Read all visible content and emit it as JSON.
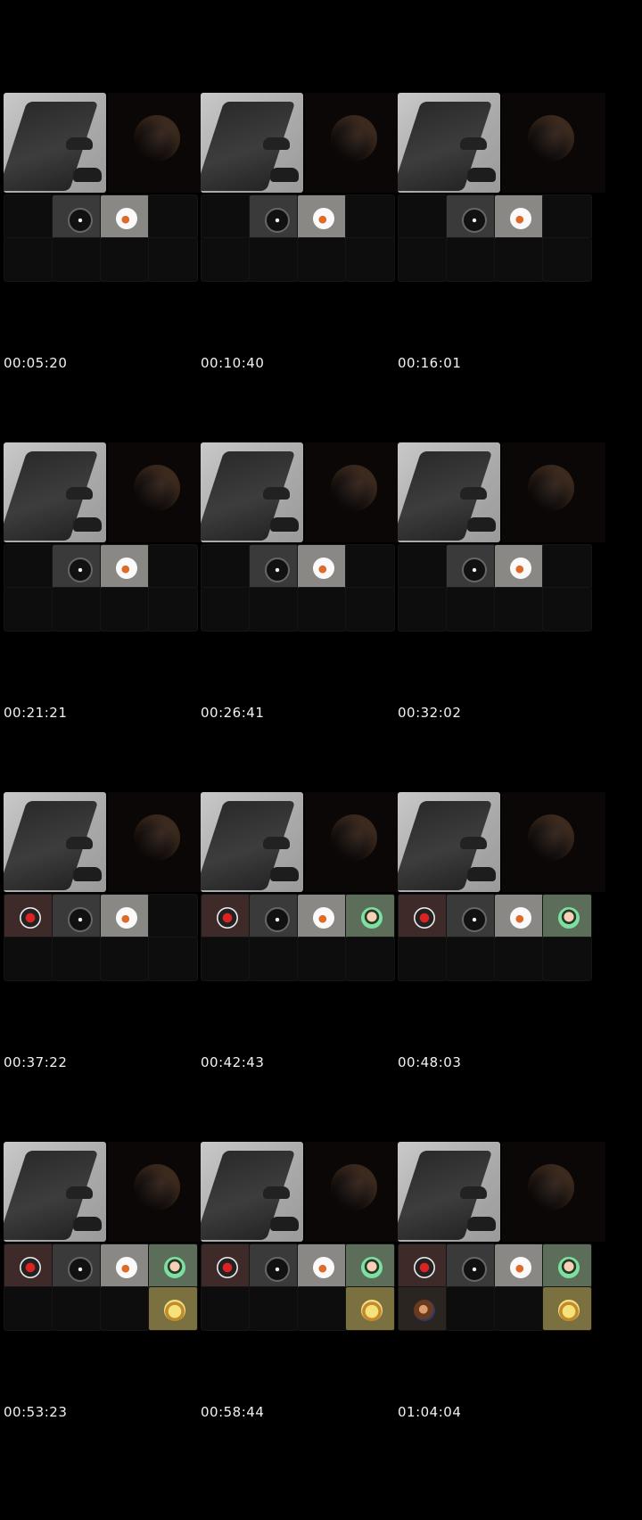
{
  "frames": [
    {
      "timestamp": "00:05:20",
      "participants": [
        "",
        "black",
        "white",
        "",
        "",
        "",
        "",
        ""
      ]
    },
    {
      "timestamp": "00:10:40",
      "participants": [
        "",
        "black",
        "white",
        "",
        "",
        "",
        "",
        ""
      ]
    },
    {
      "timestamp": "00:16:01",
      "participants": [
        "",
        "black",
        "white",
        "",
        "",
        "",
        "",
        ""
      ]
    },
    {
      "timestamp": "00:21:21",
      "participants": [
        "",
        "black",
        "white",
        "",
        "",
        "",
        "",
        ""
      ]
    },
    {
      "timestamp": "00:26:41",
      "participants": [
        "",
        "black",
        "white",
        "",
        "",
        "",
        "",
        ""
      ]
    },
    {
      "timestamp": "00:32:02",
      "participants": [
        "",
        "black",
        "white",
        "",
        "",
        "",
        "",
        ""
      ]
    },
    {
      "timestamp": "00:37:22",
      "participants": [
        "red",
        "black",
        "white",
        "",
        "",
        "",
        "",
        ""
      ]
    },
    {
      "timestamp": "00:42:43",
      "participants": [
        "red",
        "black",
        "white",
        "green",
        "",
        "",
        "",
        ""
      ]
    },
    {
      "timestamp": "00:48:03",
      "participants": [
        "red",
        "black",
        "white",
        "green",
        "",
        "",
        "",
        ""
      ]
    },
    {
      "timestamp": "00:53:23",
      "participants": [
        "red",
        "black",
        "white",
        "green",
        "",
        "",
        "",
        "yellow"
      ]
    },
    {
      "timestamp": "00:58:44",
      "participants": [
        "red",
        "black",
        "white",
        "green",
        "",
        "",
        "",
        "yellow"
      ]
    },
    {
      "timestamp": "01:04:04",
      "participants": [
        "red",
        "black",
        "white",
        "green",
        "photo",
        "",
        "",
        "yellow"
      ]
    }
  ],
  "colors": {
    "background": "#000000",
    "text": "#f2f2f2"
  },
  "icons": {
    "black": "disc-avatar-icon",
    "white": "bird-avatar-icon",
    "red": "red-mask-avatar-icon",
    "green": "cartoon-person-avatar-icon",
    "yellow": "burger-avatar-icon",
    "photo": "photo-avatar-icon"
  }
}
